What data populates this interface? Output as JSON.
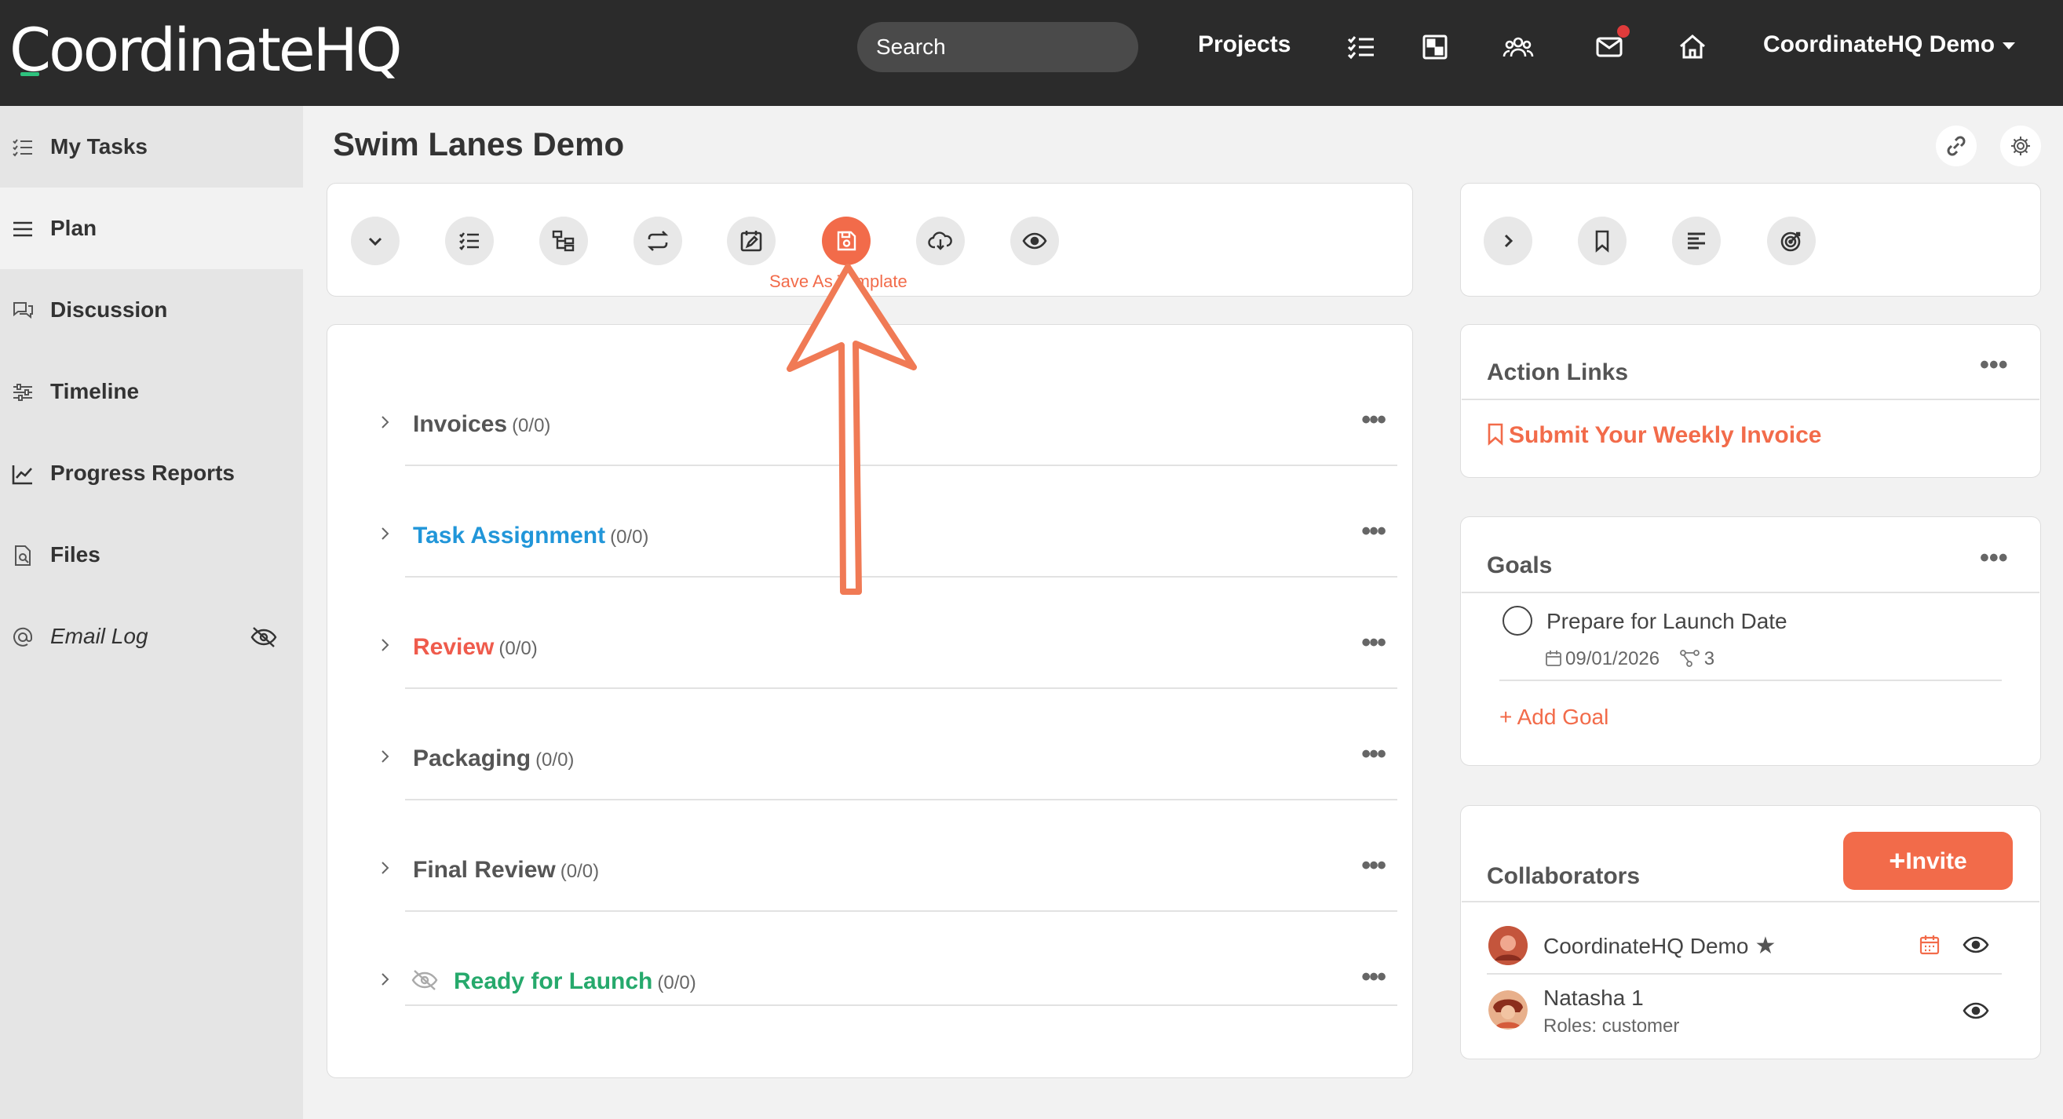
{
  "brand": {
    "logo_text": "CoordinateHQ",
    "accent": "#f26b4a",
    "topbar_bg": "#2b2b2b"
  },
  "header": {
    "search_placeholder": "Search",
    "projects_label": "Projects",
    "user_label": "CoordinateHQ Demo",
    "icons": [
      "tasks-icon",
      "board-icon",
      "team-icon",
      "mail-icon",
      "home-icon"
    ]
  },
  "sidebar": {
    "items": [
      {
        "label": "My Tasks",
        "icon": "task-list-icon"
      },
      {
        "label": "Plan",
        "icon": "menu-lines-icon"
      },
      {
        "label": "Discussion",
        "icon": "chat-icon"
      },
      {
        "label": "Timeline",
        "icon": "sliders-icon"
      },
      {
        "label": "Progress Reports",
        "icon": "chart-icon"
      },
      {
        "label": "Files",
        "icon": "file-search-icon"
      },
      {
        "label": "Email Log",
        "icon": "at-icon"
      }
    ]
  },
  "page": {
    "title": "Swim Lanes Demo"
  },
  "toolbar": {
    "tooltip": "Save As Template",
    "buttons": [
      "collapse-icon",
      "checklist-icon",
      "hierarchy-icon",
      "repeat-icon",
      "calendar-edit-icon",
      "save-icon",
      "cloud-download-icon",
      "eye-icon"
    ]
  },
  "lanes": [
    {
      "name": "Invoices",
      "count": "(0/0)",
      "color": "#555555"
    },
    {
      "name": "Task Assignment",
      "count": "(0/0)",
      "color": "#2196d9"
    },
    {
      "name": "Review",
      "count": "(0/0)",
      "color": "#ef5b4c"
    },
    {
      "name": "Packaging",
      "count": "(0/0)",
      "color": "#555555"
    },
    {
      "name": "Final Review",
      "count": "(0/0)",
      "color": "#555555"
    },
    {
      "name": "Ready for Launch",
      "count": "(0/0)",
      "color": "#26a96c"
    }
  ],
  "action_links": {
    "title": "Action Links",
    "links": [
      "Submit Your Weekly Invoice"
    ]
  },
  "goals": {
    "title": "Goals",
    "items": [
      {
        "name": "Prepare for Launch Date",
        "date": "09/01/2026",
        "linked": "3"
      }
    ],
    "add_label": "+ Add Goal"
  },
  "collaborators": {
    "title": "Collaborators",
    "invite_label": "Invite",
    "people": [
      {
        "name": "CoordinateHQ Demo",
        "role": ""
      },
      {
        "name": "Natasha 1",
        "role": "Roles: customer"
      }
    ]
  }
}
